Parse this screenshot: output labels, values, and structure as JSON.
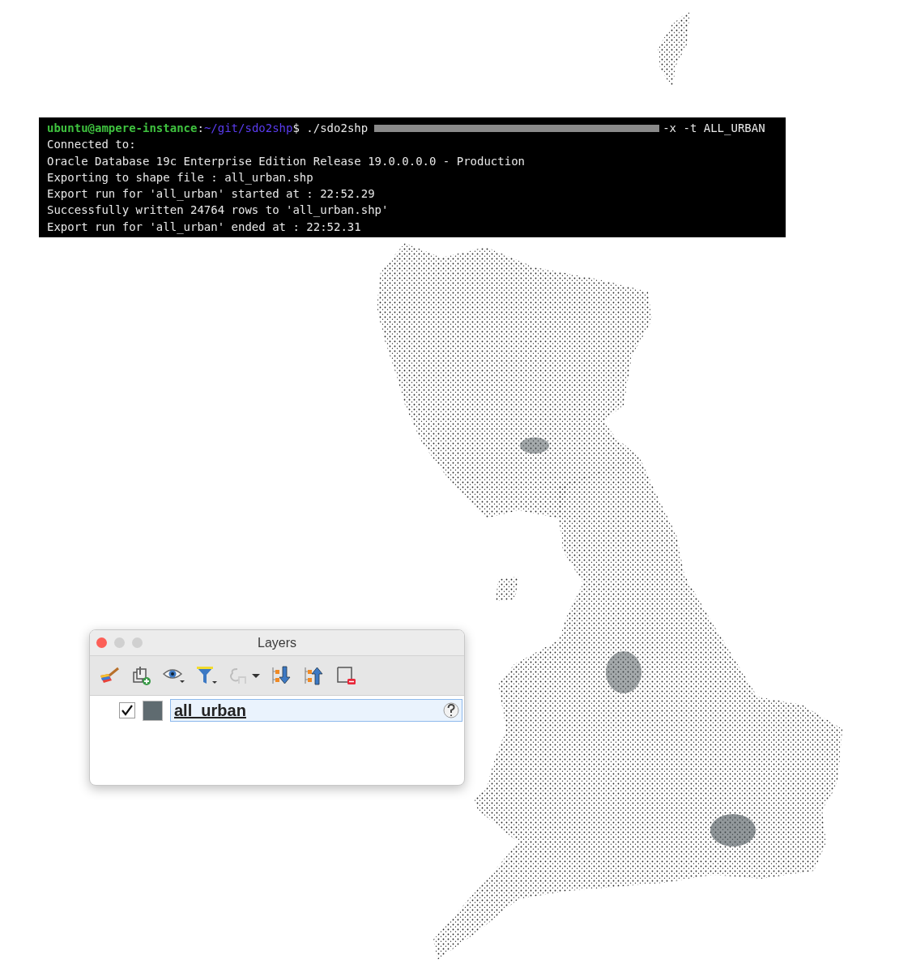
{
  "terminal": {
    "prompt_user": "ubuntu@ampere-instance",
    "prompt_separator": ":",
    "prompt_path": "~/git/sdo2shp",
    "prompt_symbol": "$",
    "command": "./sdo2shp",
    "command_args": "-x -t ALL_URBAN",
    "output": [
      "Connected to:",
      "Oracle Database 19c Enterprise Edition Release 19.0.0.0.0 - Production",
      "Exporting to shape file : all_urban.shp",
      "Export run for 'all_urban' started at : 22:52.29",
      "Successfully written 24764 rows to 'all_urban.shp'",
      "Export run for 'all_urban' ended at : 22:52.31"
    ]
  },
  "layers_panel": {
    "title": "Layers",
    "layers": [
      {
        "name": "all_urban",
        "checked": true,
        "selected": true,
        "color": "#5f6b70"
      }
    ]
  }
}
